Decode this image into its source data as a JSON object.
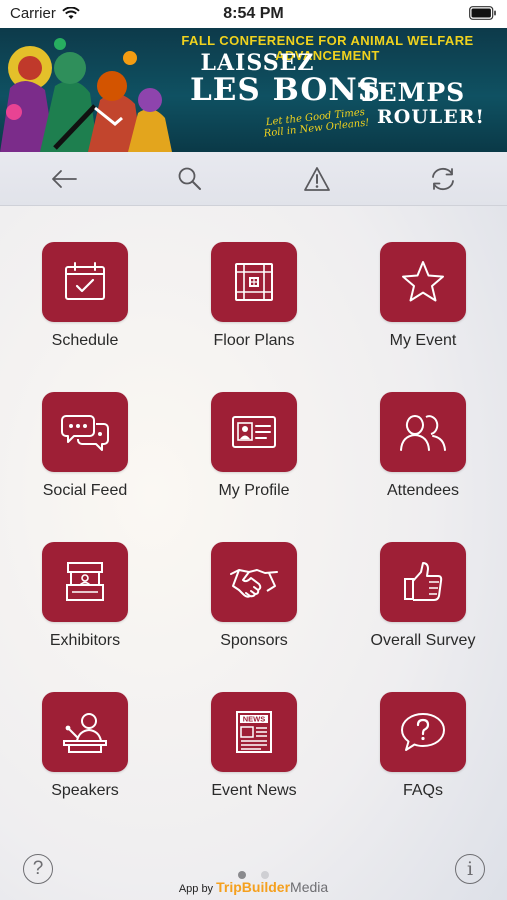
{
  "status_bar": {
    "carrier": "Carrier",
    "time": "8:54 PM"
  },
  "banner": {
    "headline": "FALL CONFERENCE FOR ANIMAL WELFARE ADVANCEMENT",
    "line1": "LAISSEZ",
    "line2": "LES BONS",
    "line2b": "TEMPS",
    "line3": "ROULER!",
    "tagline": "Let the Good Times Roll in New Orleans!"
  },
  "toolbar": {
    "icons": [
      "back-arrow-icon",
      "search-icon",
      "alert-icon",
      "refresh-icon"
    ]
  },
  "tiles": [
    {
      "label": "Schedule",
      "icon": "calendar-icon"
    },
    {
      "label": "Floor Plans",
      "icon": "floor-plan-icon"
    },
    {
      "label": "My Event",
      "icon": "star-icon"
    },
    {
      "label": "Social Feed",
      "icon": "chat-bubbles-icon"
    },
    {
      "label": "My Profile",
      "icon": "id-card-icon"
    },
    {
      "label": "Attendees",
      "icon": "people-icon"
    },
    {
      "label": "Exhibitors",
      "icon": "booth-icon"
    },
    {
      "label": "Sponsors",
      "icon": "handshake-icon"
    },
    {
      "label": "Overall Survey",
      "icon": "thumbs-up-icon"
    },
    {
      "label": "Speakers",
      "icon": "speaker-podium-icon"
    },
    {
      "label": "Event News",
      "icon": "newspaper-icon"
    },
    {
      "label": "FAQs",
      "icon": "question-bubble-icon"
    }
  ],
  "footer": {
    "help_symbol": "?",
    "info_symbol": "i",
    "page_dots": {
      "count": 2,
      "active_index": 0
    },
    "credit_prefix": "App by",
    "credit_brand_a": "TripBuilder",
    "credit_brand_b": "Media"
  },
  "colors": {
    "tile_background": "#9e1f36",
    "banner_background": "#0f5162",
    "accent_yellow": "#f0d21e",
    "brand_orange": "#f5a01e"
  }
}
